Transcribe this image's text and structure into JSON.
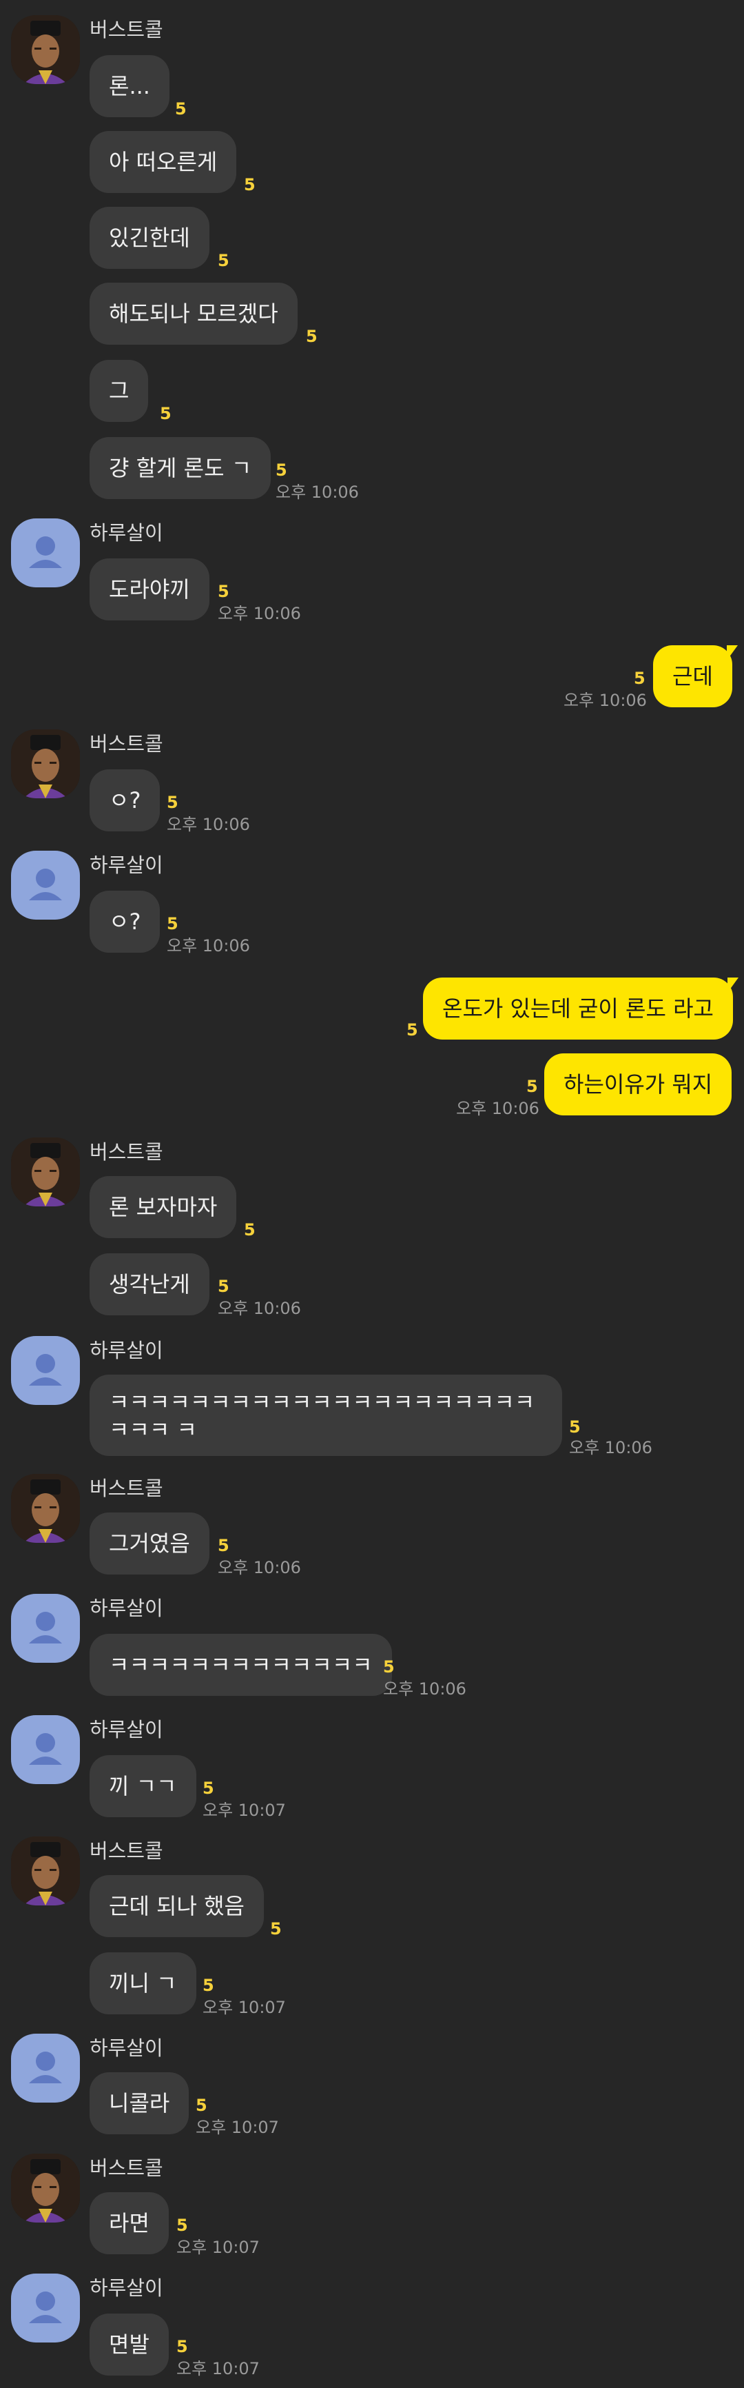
{
  "people": {
    "burst": "버스트콜",
    "haru": "하루살이"
  },
  "messages": [
    {
      "text": "론...",
      "unread": "5"
    },
    {
      "text": "아 떠오른게",
      "unread": "5"
    },
    {
      "text": "있긴한데",
      "unread": "5"
    },
    {
      "text": "해도되나 모르겠다",
      "unread": "5"
    },
    {
      "text": "그",
      "unread": "5"
    },
    {
      "text": "걍 할게 론도 ㄱ",
      "unread": "5",
      "time": "오후 10:06"
    },
    {
      "text": "도라야끼",
      "unread": "5",
      "time": "오후 10:06"
    },
    {
      "text": "근데",
      "unread": "5",
      "time": "오후 10:06"
    },
    {
      "text": "ㅇ?",
      "unread": "5",
      "time": "오후 10:06"
    },
    {
      "text": "ㅇ?",
      "unread": "5",
      "time": "오후 10:06"
    },
    {
      "text": "온도가 있는데 굳이 론도 라고",
      "unread": "5"
    },
    {
      "text": "하는이유가 뭐지",
      "unread": "5",
      "time": "오후 10:06"
    },
    {
      "text": "론 보자마자",
      "unread": "5"
    },
    {
      "text": "생각난게",
      "unread": "5",
      "time": "오후 10:06"
    },
    {
      "text": "ㅋㅋㅋㅋㅋㅋㅋㅋㅋㅋㅋㅋㅋㅋㅋㅋㅋㅋㅋㅋㅋㅋㅋㅋ ㅋ",
      "unread": "5",
      "time": "오후 10:06"
    },
    {
      "text": "그거였음",
      "unread": "5",
      "time": "오후 10:06"
    },
    {
      "text": "ㅋㅋㅋㅋㅋㅋㅋㅋㅋㅋㅋㅋㅋ",
      "unread": "5",
      "time": "오후 10:06"
    },
    {
      "text": "끼 ㄱㄱ",
      "unread": "5",
      "time": "오후 10:07"
    },
    {
      "text": "근데 되나 했음",
      "unread": "5"
    },
    {
      "text": "끼니 ㄱ",
      "unread": "5",
      "time": "오후 10:07"
    },
    {
      "text": "니콜라",
      "unread": "5",
      "time": "오후 10:07"
    },
    {
      "text": "라면",
      "unread": "5",
      "time": "오후 10:07"
    },
    {
      "text": "면발",
      "unread": "5",
      "time": "오후 10:07"
    }
  ]
}
